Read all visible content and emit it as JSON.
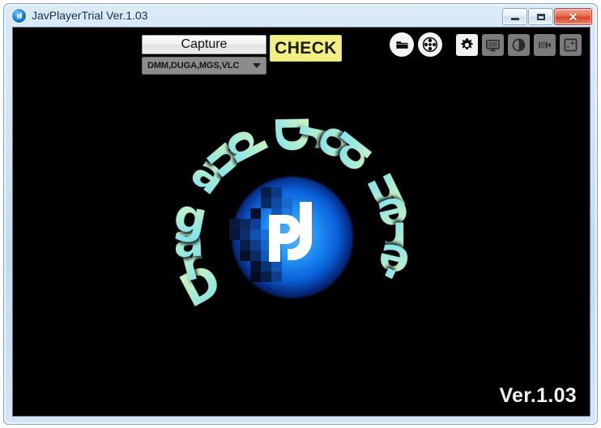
{
  "window": {
    "title": "JavPlayerTrial Ver.1.03",
    "app_icon": "jp-logo-icon",
    "controls": {
      "minimize": "minimize-button",
      "maximize": "maximize-button",
      "close_label": "✕"
    }
  },
  "toolbar": {
    "capture_label": "Capture",
    "check_label": "CHECK",
    "source_select": {
      "value": "DMM,DUGA,MGS,VLC",
      "options": [
        "DMM,DUGA,MGS,VLC"
      ]
    },
    "icons": [
      {
        "name": "folder-open-icon",
        "shape": "circle",
        "active": false
      },
      {
        "name": "film-reel-icon",
        "shape": "circle",
        "active": false
      },
      {
        "name": "gear-icon",
        "shape": "square",
        "active": true
      },
      {
        "name": "monitor-icon",
        "shape": "square",
        "active": false
      },
      {
        "name": "brightness-icon",
        "shape": "square",
        "active": false
      },
      {
        "name": "video-camera-icon",
        "shape": "square",
        "active": false
      },
      {
        "name": "image-enhance-icon",
        "shape": "square",
        "active": false
      }
    ]
  },
  "dropzone": {
    "circular_text": "Drag and Drop here.",
    "logo_text": "JP",
    "hint_letters": [
      "D",
      "r",
      "a",
      "g",
      " ",
      "a",
      "n",
      "d",
      " ",
      "D",
      "r",
      "o",
      "p",
      " ",
      "h",
      "e",
      "r",
      "e",
      "."
    ]
  },
  "footer": {
    "version": "Ver.1.03"
  },
  "colors": {
    "frame": "#cfe2f2",
    "content_bg": "#000000",
    "check_button": "#f0f084",
    "capture_button": "#f1f1f1",
    "select_bg": "#8c8c8c",
    "logo_blue": "#1f8ff5",
    "text_gradient_start": "#d8f5b8",
    "text_gradient_end": "#7fe0ec",
    "title_text": "#0b2b48"
  }
}
